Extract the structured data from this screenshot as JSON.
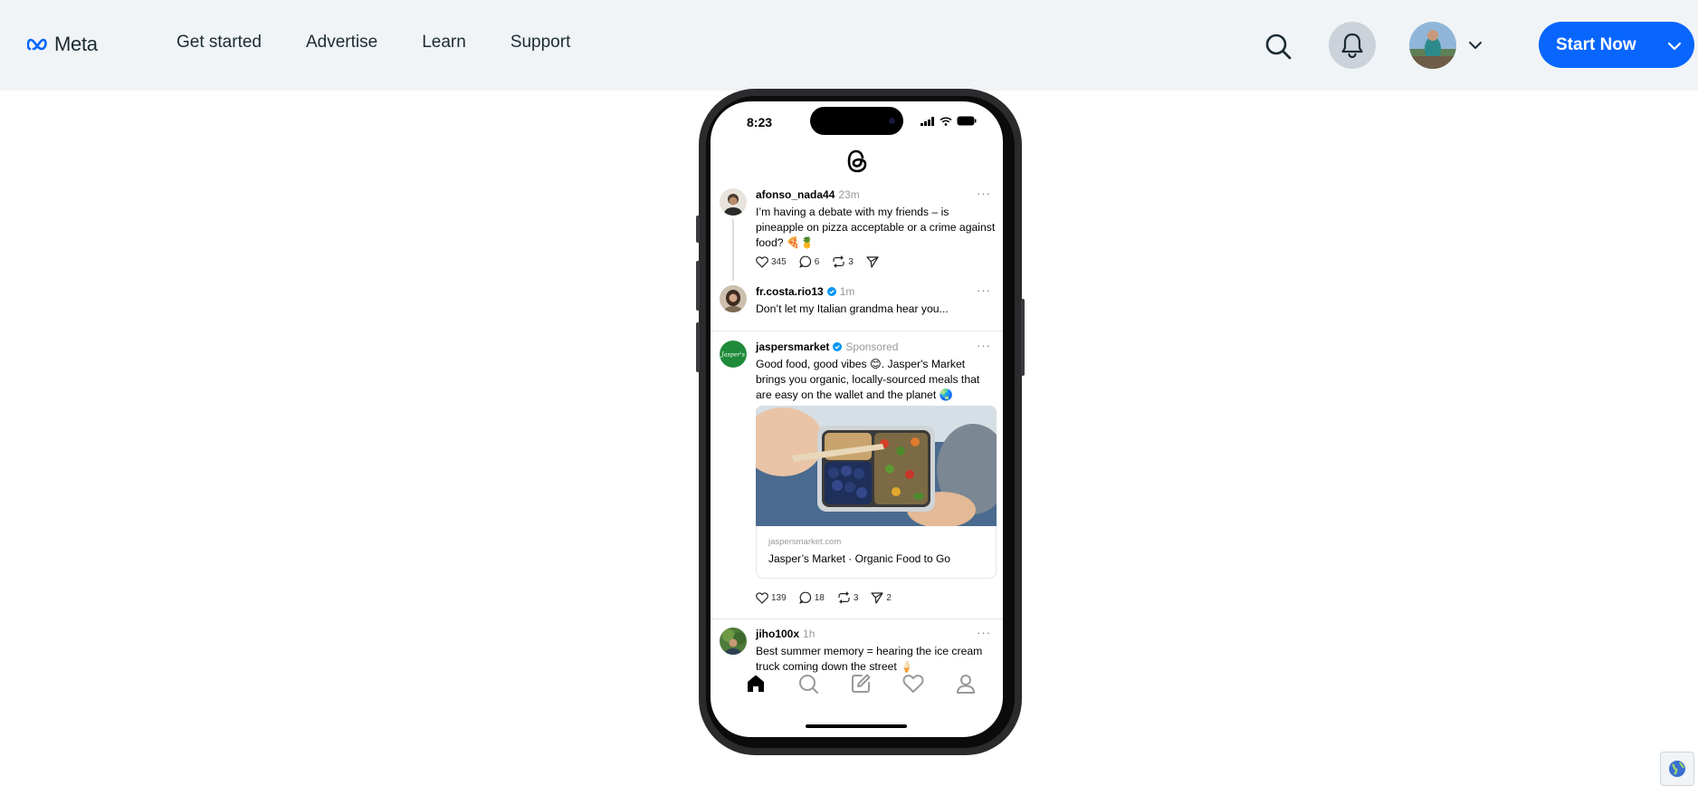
{
  "nav": {
    "logo_text": "Meta",
    "links": [
      "Get started",
      "Advertise",
      "Learn",
      "Support"
    ],
    "start_label": "Start Now",
    "icons": [
      "search-icon",
      "bell-icon",
      "chevron-down-icon"
    ]
  },
  "phone": {
    "time": "8:23",
    "posts": [
      {
        "user": "afonso_nada44",
        "meta": "23m",
        "text": "I’m having a debate with my friends – is pineapple on pizza acceptable or a crime against food? 🍕🍍",
        "likes": "345",
        "replies": "6",
        "reposts": "3"
      },
      {
        "user": "fr.costa.rio13",
        "meta": "1m",
        "text": "Don’t let my Italian grandma hear you..."
      },
      {
        "user": "jaspersmarket",
        "meta": "Sponsored",
        "text": "Good food, good vibes 😊. Jasper's Market brings you organic, locally-sourced meals that are easy on the wallet and the planet 🌏",
        "link_domain": "jaspersmarket.com",
        "link_title": "Jasper’s Market · Organic Food to Go",
        "likes": "139",
        "replies": "18",
        "reposts": "3",
        "shares": "2"
      },
      {
        "user": "jiho100x",
        "meta": "1h",
        "text": "Best summer memory = hearing the ice cream truck coming down the street 🍦"
      }
    ],
    "tabs": [
      "home-icon",
      "search-icon",
      "compose-icon",
      "heart-icon",
      "profile-icon"
    ]
  },
  "colors": {
    "accent": "#0866ff",
    "nav_bg": "#f1f4f7",
    "verified": "#0095f6"
  }
}
